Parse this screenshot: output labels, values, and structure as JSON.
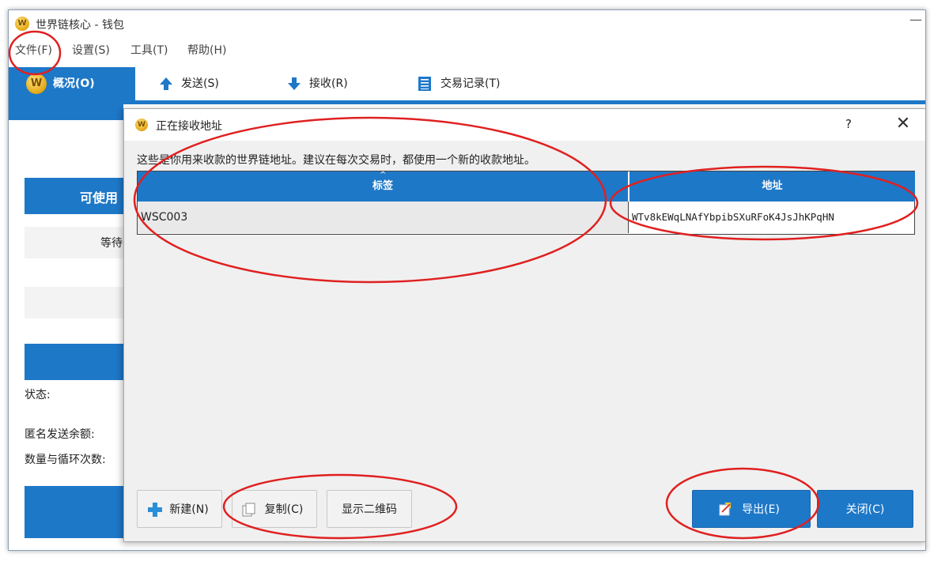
{
  "window": {
    "title": "世界链核心 - 钱包",
    "minimize_glyph": "—",
    "app_icon_letter": "W"
  },
  "menu": {
    "file": "文件(F)",
    "settings": "设置(S)",
    "tools": "工具(T)",
    "help": "帮助(H)"
  },
  "tabs": {
    "overview": "概况(O)",
    "send": "发送(S)",
    "receive": "接收(R)",
    "transactions": "交易记录(T)"
  },
  "overview_bg": {
    "available_label": "可使用",
    "waiting_label": "等待",
    "status_label": "状态:",
    "anon_balance_label": "匿名发送余额:",
    "amount_rounds_label": "数量与循环次数:"
  },
  "dialog": {
    "title": "正在接收地址",
    "help_glyph": "?",
    "close_glyph": "✕",
    "description": "这些是你用来收款的世界链地址。建议在每次交易时，都使用一个新的收款地址。",
    "table": {
      "headers": [
        "标签",
        "地址"
      ],
      "rows": [
        {
          "label": "WSC003",
          "address": "WTv8kEWqLNAfYbpibSXuRFoK4JsJhKPqHN"
        }
      ]
    },
    "buttons": {
      "new": "新建(N)",
      "copy": "复制(C)",
      "show_qr": "显示二维码",
      "export": "导出(E)",
      "close": "关闭(C)"
    }
  },
  "colors": {
    "accent_blue": "#1e78c8",
    "annotation_red": "#e02020"
  }
}
